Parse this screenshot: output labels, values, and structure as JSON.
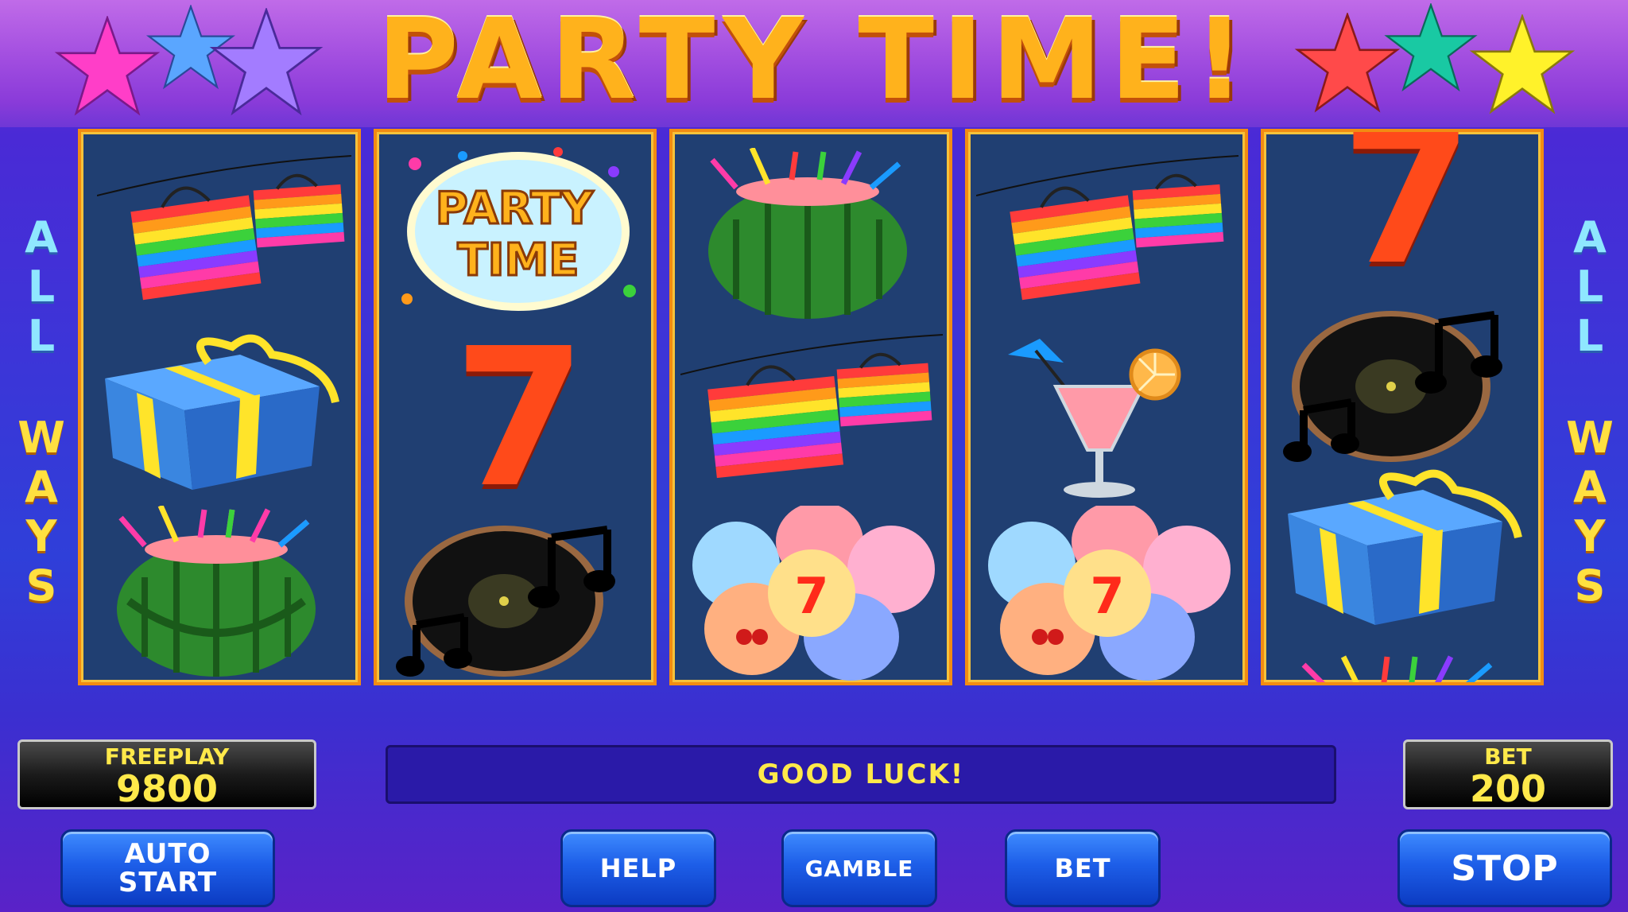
{
  "game": {
    "title": "PARTY TIME!",
    "side_top": [
      "A",
      "L",
      "L"
    ],
    "side_bottom": [
      "W",
      "A",
      "Y",
      "S"
    ]
  },
  "reels": [
    [
      "lanterns-icon",
      "gift-box-icon",
      "watermelon-drink-icon"
    ],
    [
      "party-time-logo-icon",
      "seven-icon",
      "vinyl-record-icon"
    ],
    [
      "watermelon-drink-icon",
      "lanterns-icon",
      "balloons-icon"
    ],
    [
      "lanterns-icon",
      "cocktail-icon",
      "balloons-icon"
    ],
    [
      "seven-icon",
      "vinyl-record-icon",
      "gift-box-icon"
    ]
  ],
  "symbols": {
    "logo_line1": "PARTY",
    "logo_line2": "TIME",
    "seven": "7"
  },
  "counters": {
    "freeplay_label": "FREEPLAY",
    "freeplay_value": "9800",
    "bet_label": "BET",
    "bet_value": "200"
  },
  "message": "GOOD LUCK!",
  "buttons": {
    "auto_start_line1": "AUTO",
    "auto_start_line2": "START",
    "help": "HELP",
    "gamble": "GAMBLE",
    "bet": "BET",
    "stop": "STOP"
  },
  "colors": {
    "reel_bg": "#203f72",
    "reel_border": "#f28c12",
    "counter_text": "#ffe94a",
    "button_blue": "#1d5ee8"
  }
}
